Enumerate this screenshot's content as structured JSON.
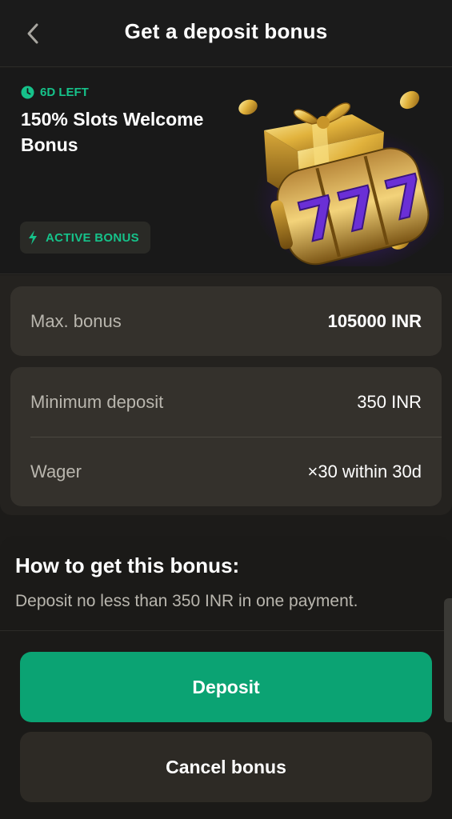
{
  "header": {
    "title": "Get a deposit bonus",
    "back_icon": "chevron-left-icon"
  },
  "promo": {
    "time_left": "6D LEFT",
    "title": "150% Slots Welcome Bonus",
    "status_badge": "ACTIVE BONUS",
    "accent_color": "#16c28a",
    "art_description_icons": [
      "gift-icon",
      "slot-777-icon",
      "coin-icon"
    ]
  },
  "details": {
    "max_bonus_label": "Max. bonus",
    "max_bonus_value": "105000 INR",
    "min_deposit_label": "Minimum deposit",
    "min_deposit_value": "350 INR",
    "wager_label": "Wager",
    "wager_value": "×30 within 30d"
  },
  "howto": {
    "title": "How to get this bonus:",
    "text": "Deposit no less than 350 INR in one payment."
  },
  "actions": {
    "deposit_label": "Deposit",
    "deposit_color": "#0ba373",
    "cancel_label": "Cancel bonus"
  }
}
